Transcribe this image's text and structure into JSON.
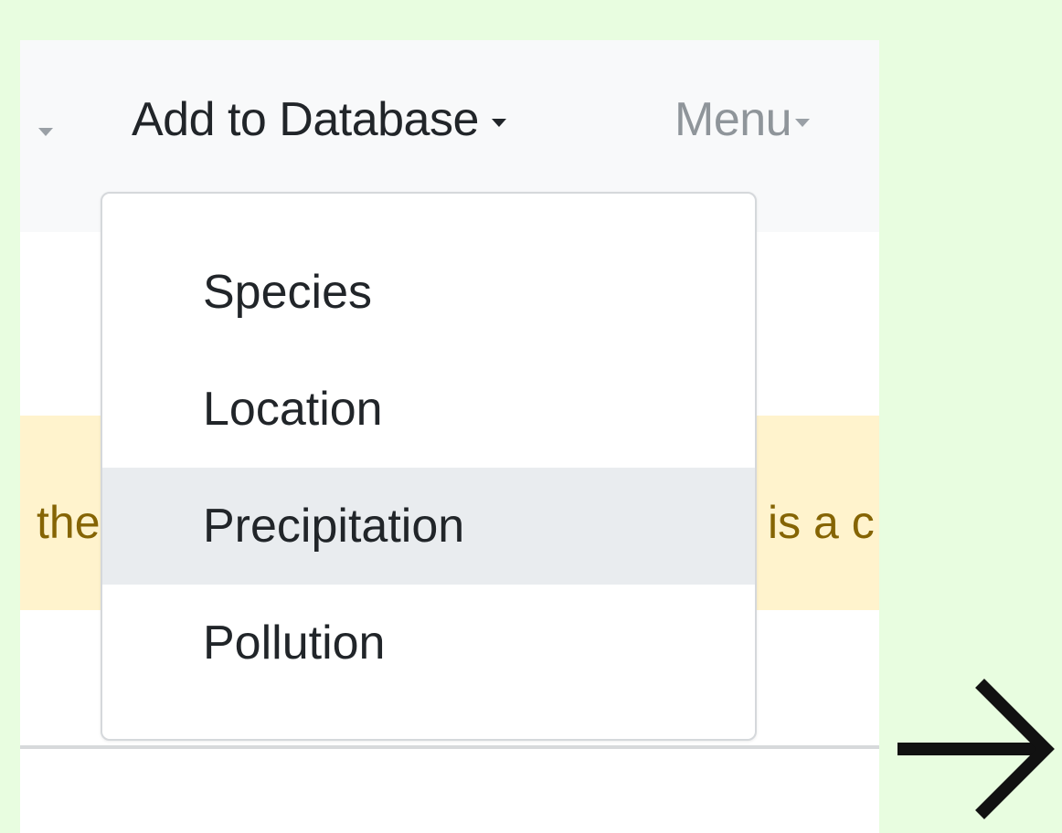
{
  "navbar": {
    "add_to_database_label": "Add to Database",
    "menu_label": "Menu"
  },
  "dropdown": {
    "items": [
      {
        "label": "Species"
      },
      {
        "label": "Location"
      },
      {
        "label": "Precipitation",
        "highlighted": true
      },
      {
        "label": "Pollution"
      }
    ]
  },
  "alert": {
    "text_left": "the",
    "text_right": "is a c"
  },
  "arrow": {
    "icon": "arrow-right-icon"
  },
  "colors": {
    "page_background": "#e8fde0",
    "navbar_background": "#f8f9fa",
    "alert_background": "#fff3cd",
    "alert_text": "#856404",
    "highlight": "#e9ecef"
  }
}
